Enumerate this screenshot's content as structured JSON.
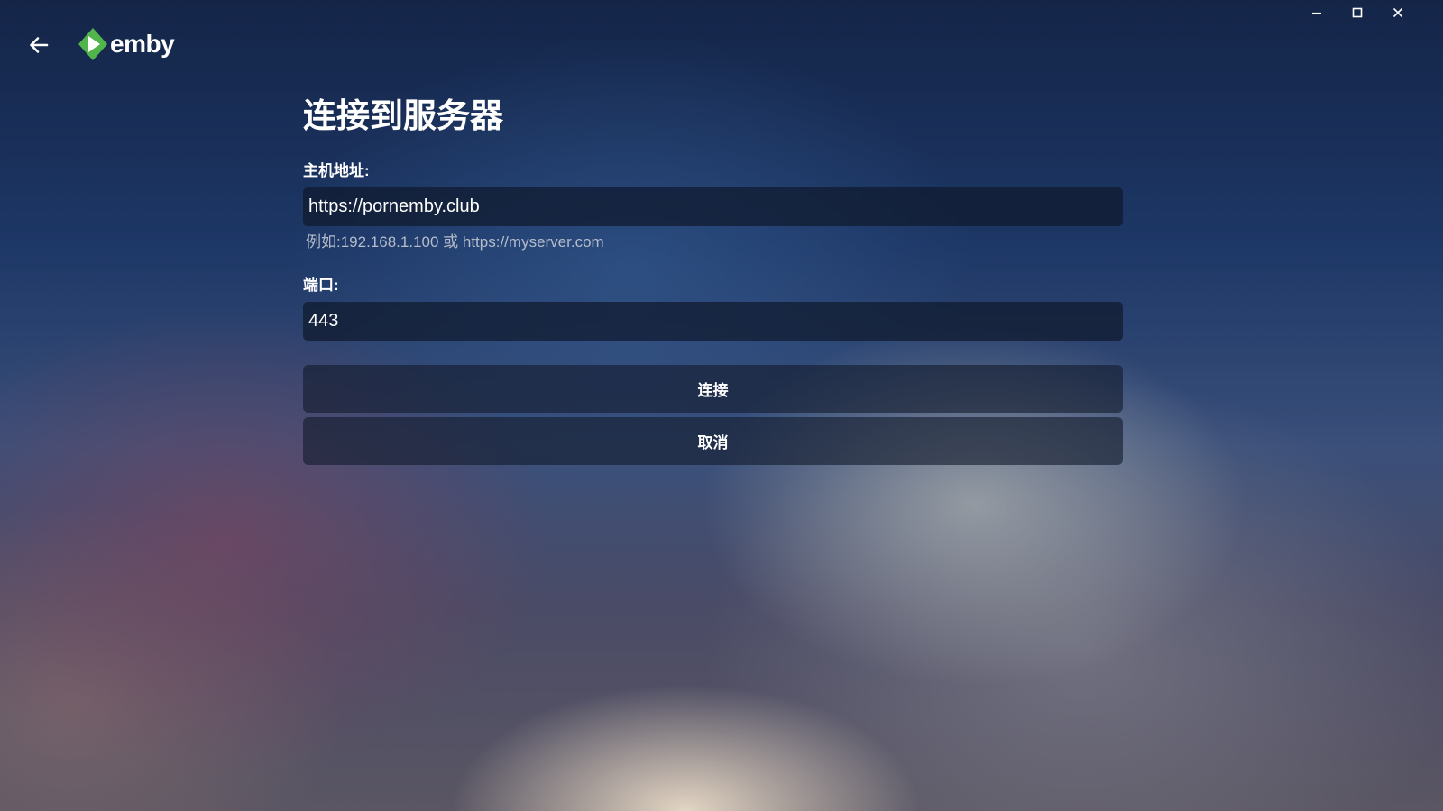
{
  "window": {
    "minimize_icon": "minimize-icon",
    "maximize_icon": "maximize-icon",
    "close_icon": "close-icon"
  },
  "header": {
    "back_icon": "arrow-left-icon",
    "logo_text": "emby",
    "logo_color": "#52b54b"
  },
  "form": {
    "title": "连接到服务器",
    "host_label": "主机地址:",
    "host_value": "https://pornemby.club",
    "host_hint": "例如:192.168.1.100 或 https://myserver.com",
    "port_label": "端口:",
    "port_value": "443",
    "connect_label": "连接",
    "cancel_label": "取消"
  }
}
